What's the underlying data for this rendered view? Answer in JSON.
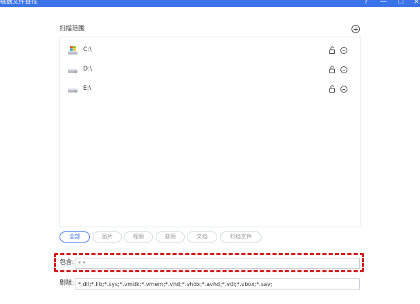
{
  "window": {
    "title": "磁盘文件查找",
    "help": "?",
    "minimize": "—",
    "maximize": "☐",
    "close": "×"
  },
  "scan_range": {
    "label": "扫描范围",
    "drives": [
      {
        "label": "C:\\",
        "icon": "windows-drive-icon"
      },
      {
        "label": "D:\\",
        "icon": "disk-drive-icon"
      },
      {
        "label": "E:\\",
        "icon": "disk-drive-icon"
      }
    ]
  },
  "filter_tabs": [
    "全部",
    "图片",
    "视频",
    "音频",
    "文档",
    "归档文件"
  ],
  "include": {
    "label": "包含:",
    "value": "*.*"
  },
  "exclude": {
    "label": "剔除:",
    "value": "*.dll;*.lib;*.sys;*.vmdk;*.vmem;*.vhd;*.vhdx;*.avhd;*.vdi;*.vbox;*.sav;"
  },
  "colors": {
    "accent": "#3b73e8",
    "highlight": "#d21f1f"
  }
}
